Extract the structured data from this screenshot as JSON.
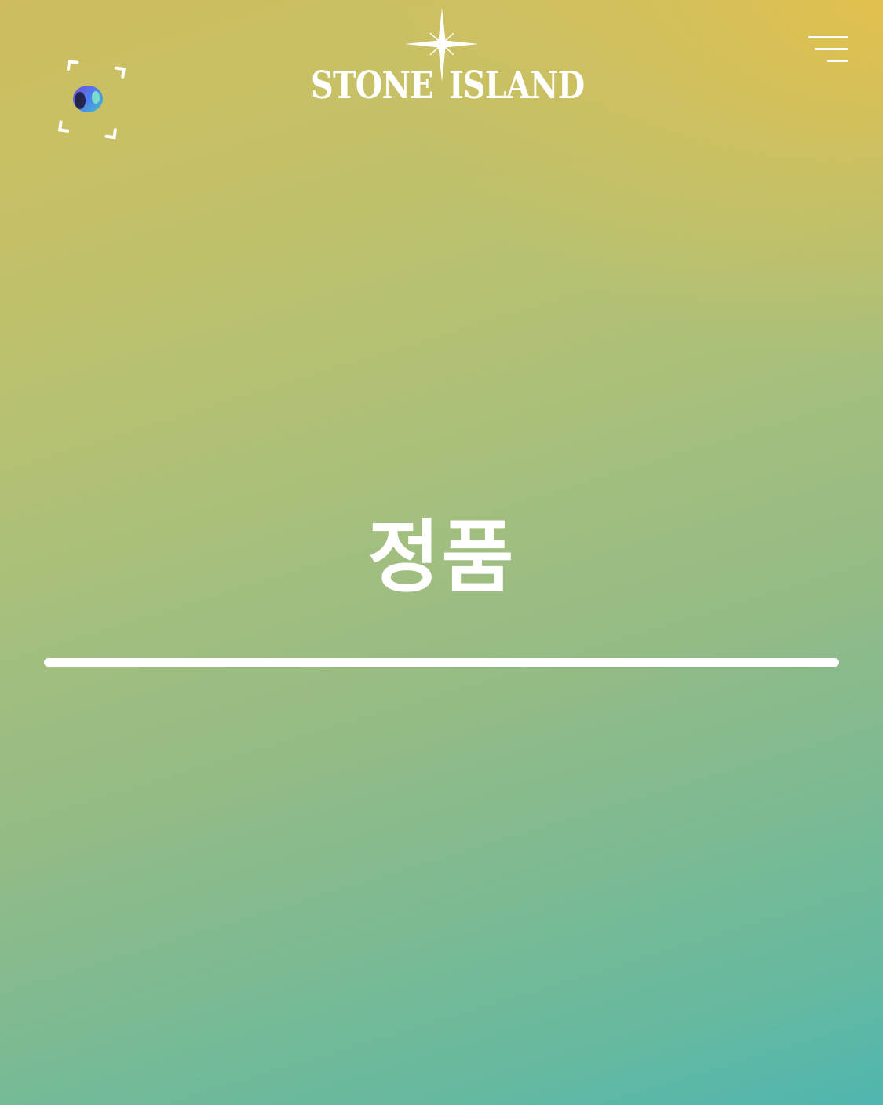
{
  "header": {
    "brand_left": "STONE",
    "brand_right": "ISLAND",
    "ar_button_icon": "ar-camera-icon",
    "menu_icon": "hamburger-menu-icon"
  },
  "main": {
    "title": "정품"
  },
  "colors": {
    "gradient_top": "#e8c048",
    "gradient_mid": "#a8bf7c",
    "gradient_bottom": "#4fb6b0",
    "text": "#ffffff"
  }
}
